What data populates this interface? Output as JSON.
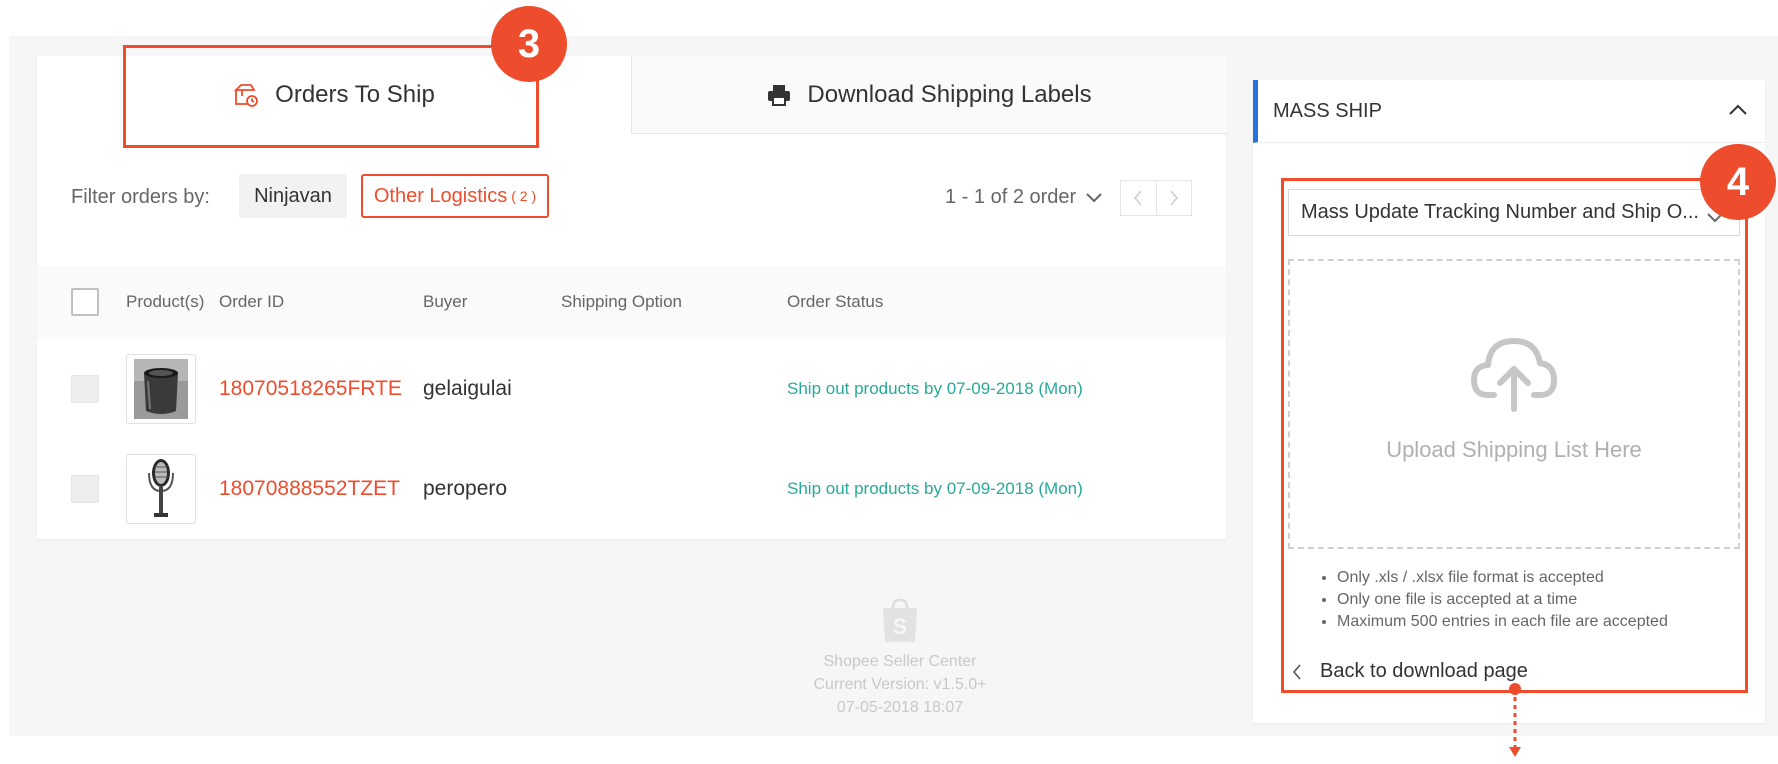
{
  "colors": {
    "accent": "#ee4d2d",
    "status_green": "#26aa99",
    "side_accent": "#2673dd"
  },
  "tabs": {
    "orders_to_ship": {
      "label": "Orders To Ship",
      "icon": "package-icon"
    },
    "download_labels": {
      "label": "Download Shipping Labels",
      "icon": "printer-icon"
    }
  },
  "step_badges": {
    "left": "3",
    "right": "4"
  },
  "filter": {
    "label": "Filter orders by:",
    "options": [
      {
        "label": "Ninjavan"
      },
      {
        "label": "Other Logistics",
        "count": "( 2 )",
        "selected": true
      }
    ]
  },
  "pagination": {
    "text": "1 - 1 of 2 order"
  },
  "table": {
    "headers": [
      "Product(s)",
      "Order ID",
      "Buyer",
      "Shipping Option",
      "Order Status"
    ],
    "rows": [
      {
        "product_icon": "speaker-image",
        "order_id": "18070518265FRTE",
        "buyer": "gelaigulai",
        "shipping_option": "",
        "status": "Ship out products by 07-09-2018 (Mon)"
      },
      {
        "product_icon": "microphone-image",
        "order_id": "18070888552TZET",
        "buyer": "peropero",
        "shipping_option": "",
        "status": "Ship out products by 07-09-2018 (Mon)"
      }
    ]
  },
  "footer": {
    "name": "Shopee Seller Center",
    "version": "Current Version: v1.5.0+",
    "date": "07-05-2018 18:07"
  },
  "side_panel": {
    "title": "MASS SHIP",
    "select_value": "Mass Update Tracking Number and Ship O...",
    "upload_text": "Upload Shipping List Here",
    "rules": [
      "Only .xls / .xlsx file format is accepted",
      "Only one file is accepted at a time",
      "Maximum 500 entries in each file are accepted"
    ],
    "back_link": "Back to download page"
  }
}
